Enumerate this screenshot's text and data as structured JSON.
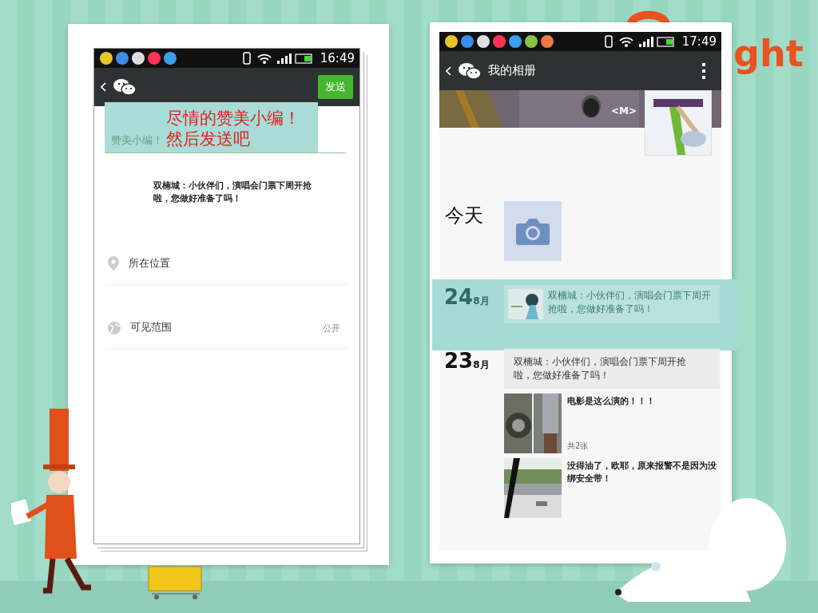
{
  "slide": {
    "decor_text": "ght"
  },
  "left_phone": {
    "status_bar": {
      "time": "16:49"
    },
    "toolbar": {
      "send_button": "发送"
    },
    "callout": {
      "hint": "赞美小编！",
      "lines": [
        "尽情的赞美小编！",
        "然后发送吧"
      ]
    },
    "shared_text": "双楠城：小伙伴们，演唱会门票下周开抢啦，您做好准备了吗！",
    "options": [
      {
        "kind": "location",
        "label": "所在位置"
      },
      {
        "kind": "visibility",
        "label": "可见范围",
        "value": "公开"
      }
    ]
  },
  "right_phone": {
    "status_bar": {
      "time": "17:49"
    },
    "toolbar": {
      "title": "我的相册"
    },
    "cover": {
      "name": "<M>"
    },
    "timeline": [
      {
        "kind": "today",
        "date": "今天"
      },
      {
        "kind": "share",
        "day": "24",
        "month": "8月",
        "highlighted": true,
        "text": "双楠城：小伙伴们，演唱会门票下周开抢啦，您做好准备了吗！"
      },
      {
        "kind": "posts",
        "day": "23",
        "month": "8月",
        "entries": [
          {
            "kind": "text",
            "text": "双楠城：小伙伴们，演唱会门票下周开抢啦，您做好准备了吗！"
          },
          {
            "text": "电影是这么演的！！！",
            "count": "共2张"
          },
          {
            "text": "没得油了，欧耶，原来报警不是因为没绑安全带！"
          }
        ]
      }
    ]
  }
}
